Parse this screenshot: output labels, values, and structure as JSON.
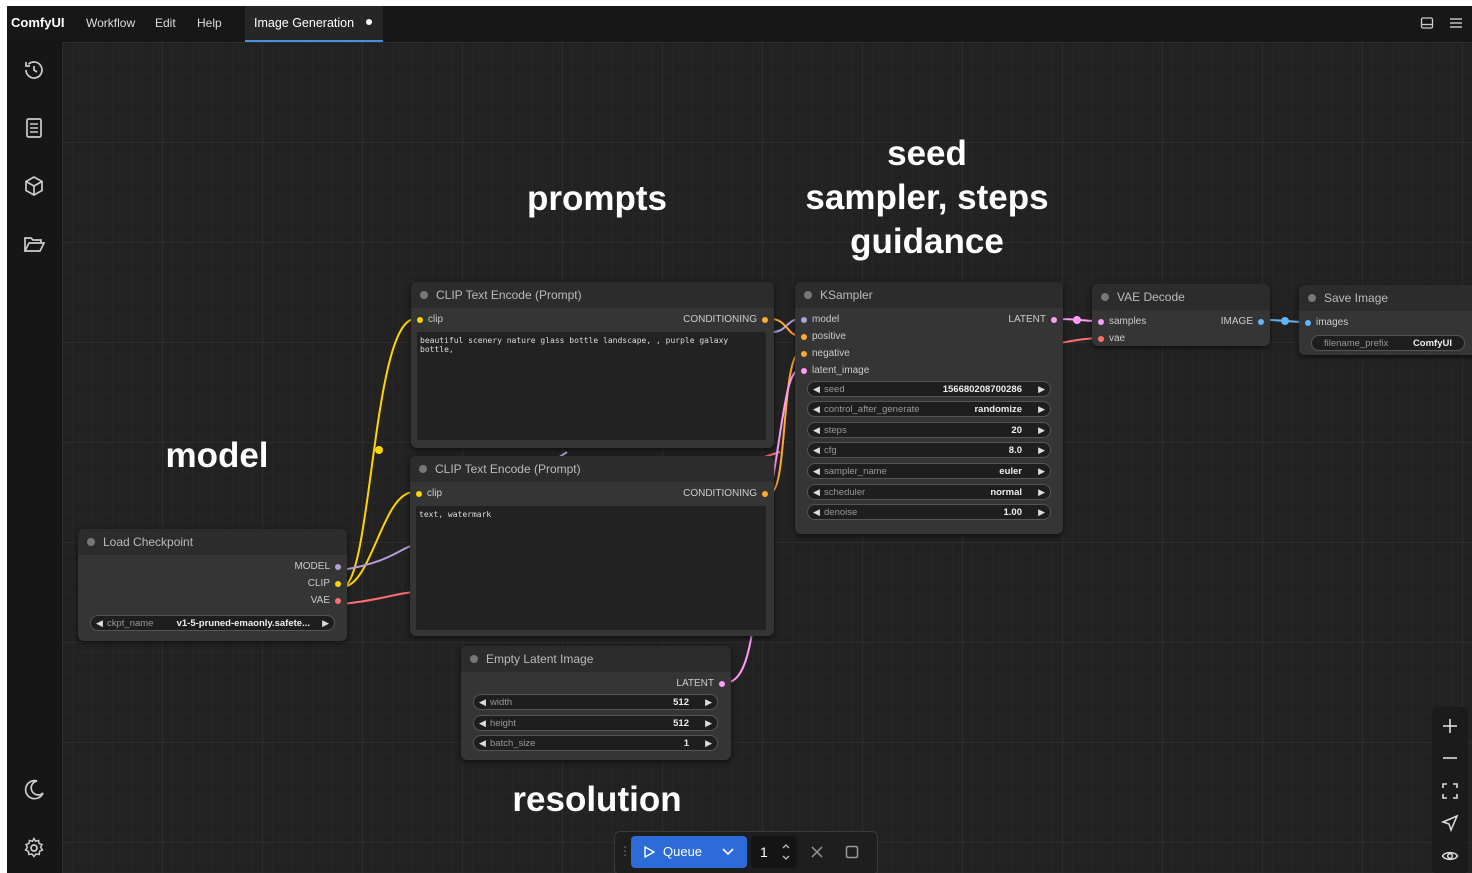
{
  "menubar": {
    "logo": "ComfyUI",
    "items": [
      "Workflow",
      "Edit",
      "Help"
    ],
    "tab": "Image Generation"
  },
  "sidebar": {
    "icons": [
      "history-icon",
      "queue-list-icon",
      "model-library-icon",
      "workflows-folder-icon",
      "theme-toggle-icon",
      "settings-icon"
    ]
  },
  "annotations": {
    "prompts": "prompts",
    "seed": "seed\nsampler, steps\nguidance",
    "model": "model",
    "resolution": "resolution"
  },
  "nodes": {
    "clip_pos": {
      "title": "CLIP Text Encode (Prompt)",
      "input": "clip",
      "output": "CONDITIONING",
      "text": "beautiful scenery nature glass bottle landscape, , purple galaxy bottle,"
    },
    "clip_neg": {
      "title": "CLIP Text Encode (Prompt)",
      "input": "clip",
      "output": "CONDITIONING",
      "text": "text, watermark"
    },
    "ksampler": {
      "title": "KSampler",
      "inputs": [
        "model",
        "positive",
        "negative",
        "latent_image"
      ],
      "output": "LATENT",
      "widgets": [
        {
          "name": "seed",
          "value": "156680208700286"
        },
        {
          "name": "control_after_generate",
          "value": "randomize"
        },
        {
          "name": "steps",
          "value": "20"
        },
        {
          "name": "cfg",
          "value": "8.0"
        },
        {
          "name": "sampler_name",
          "value": "euler"
        },
        {
          "name": "scheduler",
          "value": "normal"
        },
        {
          "name": "denoise",
          "value": "1.00"
        }
      ]
    },
    "vae_decode": {
      "title": "VAE Decode",
      "inputs": [
        "samples",
        "vae"
      ],
      "output": "IMAGE"
    },
    "save_image": {
      "title": "Save Image",
      "input": "images",
      "widget": {
        "name": "filename_prefix",
        "value": "ComfyUI"
      }
    },
    "load_checkpoint": {
      "title": "Load Checkpoint",
      "outputs": [
        "MODEL",
        "CLIP",
        "VAE"
      ],
      "widget": {
        "name": "ckpt_name",
        "value": "v1-5-pruned-emaonly.safete..."
      }
    },
    "empty_latent": {
      "title": "Empty Latent Image",
      "output": "LATENT",
      "widgets": [
        {
          "name": "width",
          "value": "512"
        },
        {
          "name": "height",
          "value": "512"
        },
        {
          "name": "batch_size",
          "value": "1"
        }
      ]
    }
  },
  "queue": {
    "label": "Queue",
    "count": "1"
  },
  "colors": {
    "model": "#b39ddb",
    "clip": "#ffd500",
    "vae": "#ff6e6e",
    "conditioning": "#ffa931",
    "latent": "#ff9cf9",
    "image": "#64b5f6",
    "accent": "#2c6bd8"
  }
}
